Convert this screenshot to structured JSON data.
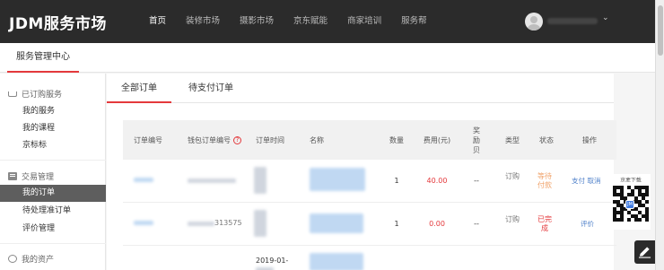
{
  "app": {
    "logo": "JDM服务市场",
    "nav": [
      "首页",
      "装修市场",
      "摄影市场",
      "京东赋能",
      "商家培训",
      "服务帮"
    ],
    "nav_active": "首页"
  },
  "header": {
    "title": "服务管理中心"
  },
  "sidebar": {
    "groups": [
      {
        "label": "已订购服务",
        "icon": "cart-icon",
        "items": [
          "我的服务",
          "我的课程",
          "京标标"
        ]
      },
      {
        "label": "交易管理",
        "icon": "box-icon",
        "items": [
          "我的订单",
          "待处理准订单",
          "评价管理"
        ]
      },
      {
        "label": "我的资产",
        "icon": "asset-icon",
        "items": []
      }
    ],
    "active_item": "我的订单"
  },
  "tabs": [
    "全部订单",
    "待支付订单"
  ],
  "table": {
    "headers": {
      "order_no": "订单编号",
      "wallet_no": "钱包订单编号",
      "order_time": "订单时间",
      "name": "名称",
      "qty": "数量",
      "fee": "费用(元)",
      "bonus": "奖励贝",
      "type": "类型",
      "status": "状态",
      "action": "操作"
    },
    "rows": [
      {
        "qty": "1",
        "fee": "40.00",
        "bonus": "--",
        "type": "订购",
        "status": "等待付款",
        "status_color": "#f0a36b",
        "actions": [
          "支付",
          "取消"
        ]
      },
      {
        "wallet_partial": "313575",
        "qty": "1",
        "fee": "0.00",
        "bonus": "--",
        "type": "订购",
        "status": "已完成",
        "status_color": "#e4393c",
        "actions": [
          "评价"
        ]
      },
      {
        "time_partial": "2019-01-",
        "qty": "",
        "fee": "",
        "bonus": "",
        "type": "",
        "status": "",
        "actions": []
      }
    ]
  },
  "qr_widget": {
    "title": "京麦下载"
  },
  "colors": {
    "accent": "#e4393c",
    "topbar": "#2b2b2b",
    "link": "#4d7fc9"
  }
}
